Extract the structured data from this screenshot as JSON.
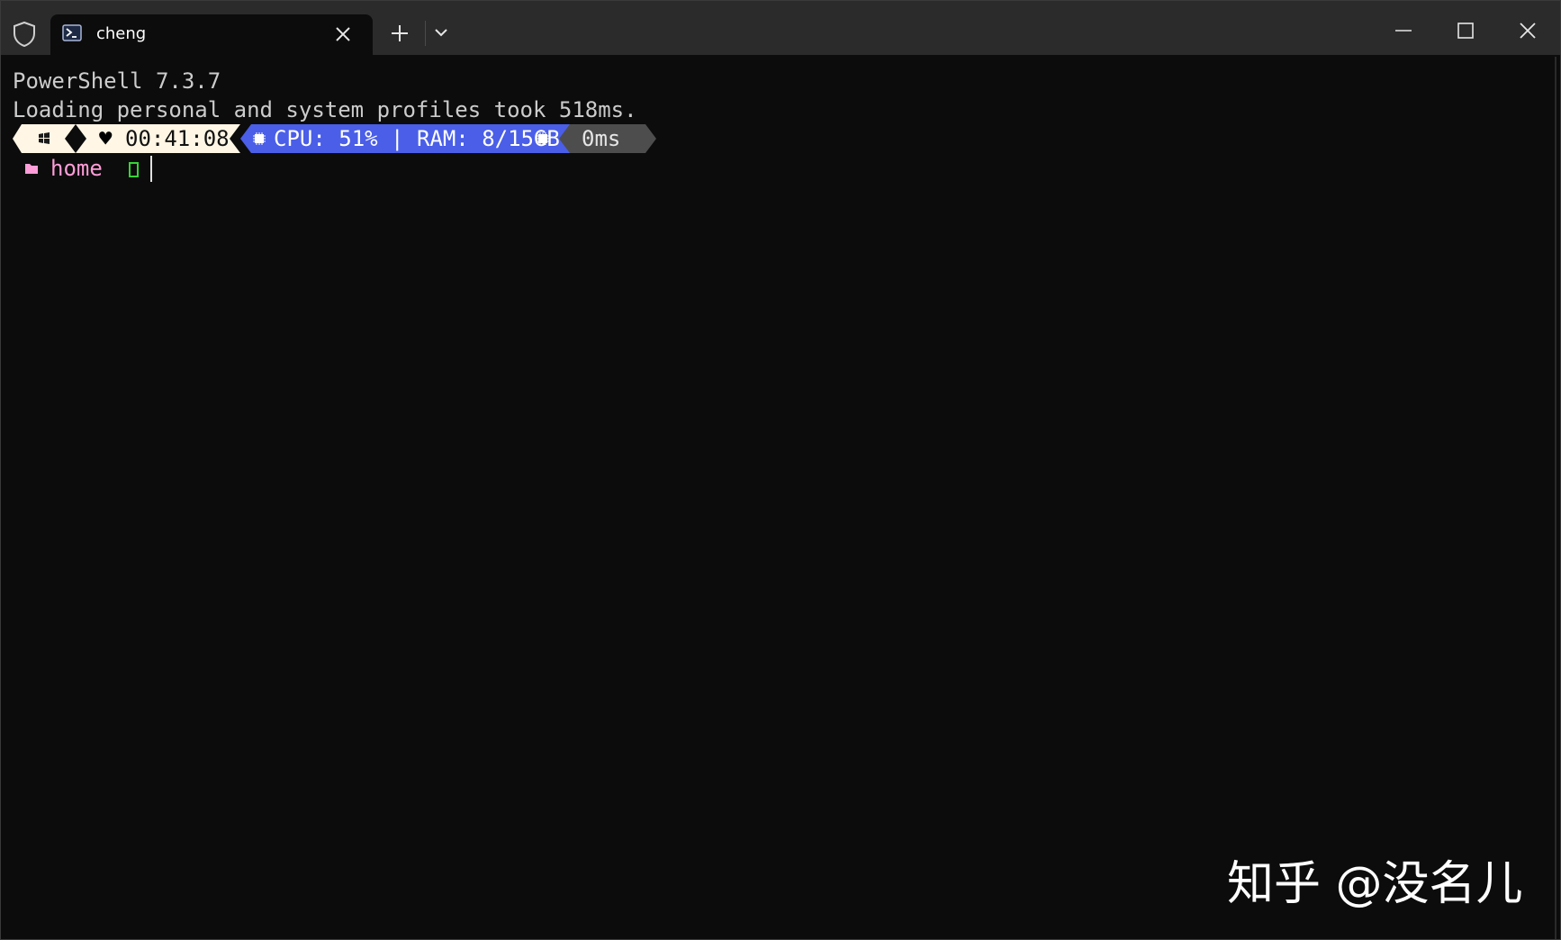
{
  "tab": {
    "title": "cheng"
  },
  "terminal": {
    "lines": [
      "PowerShell 7.3.7",
      "Loading personal and system profiles took 518ms."
    ],
    "prompt": {
      "time": "00:41:08",
      "cpu_ram": "CPU: 51% | RAM: 8/15GB",
      "duration": "0ms",
      "directory": "home"
    }
  },
  "watermark": "知乎 @没名儿",
  "colors": {
    "background": "#0c0c0c",
    "prompt_os_bg": "#fff6e5",
    "prompt_time_bg": "#fff6e5",
    "prompt_sys_bg": "#4a5ee8",
    "prompt_duration_bg": "#4d4d4d",
    "directory_text": "#ff9dd8",
    "prompt_symbol": "#33d633"
  },
  "icons": [
    "shield-icon",
    "powershell-icon",
    "close-icon",
    "plus-icon",
    "chevron-down-icon",
    "minimize-icon",
    "maximize-icon",
    "window-close-icon",
    "windows-logo-icon",
    "heart-icon",
    "chip-icon",
    "folder-icon"
  ]
}
